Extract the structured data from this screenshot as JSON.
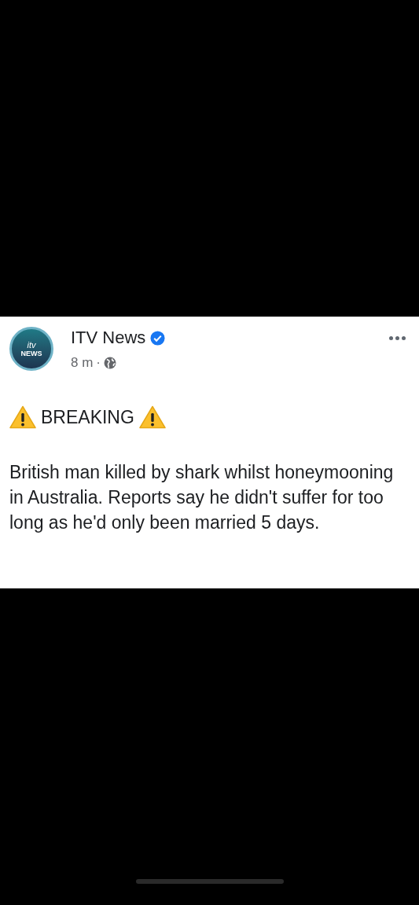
{
  "post": {
    "avatar": {
      "line_1": "itv",
      "line_2": "NEWS"
    },
    "author": "ITV News",
    "verified": true,
    "time": "8 m",
    "separator": "·",
    "headline": "BREAKING",
    "body": "British man killed by shark whilst honeymooning in Australia. Reports say he didn't suffer for too long as he'd only been married 5 days."
  }
}
